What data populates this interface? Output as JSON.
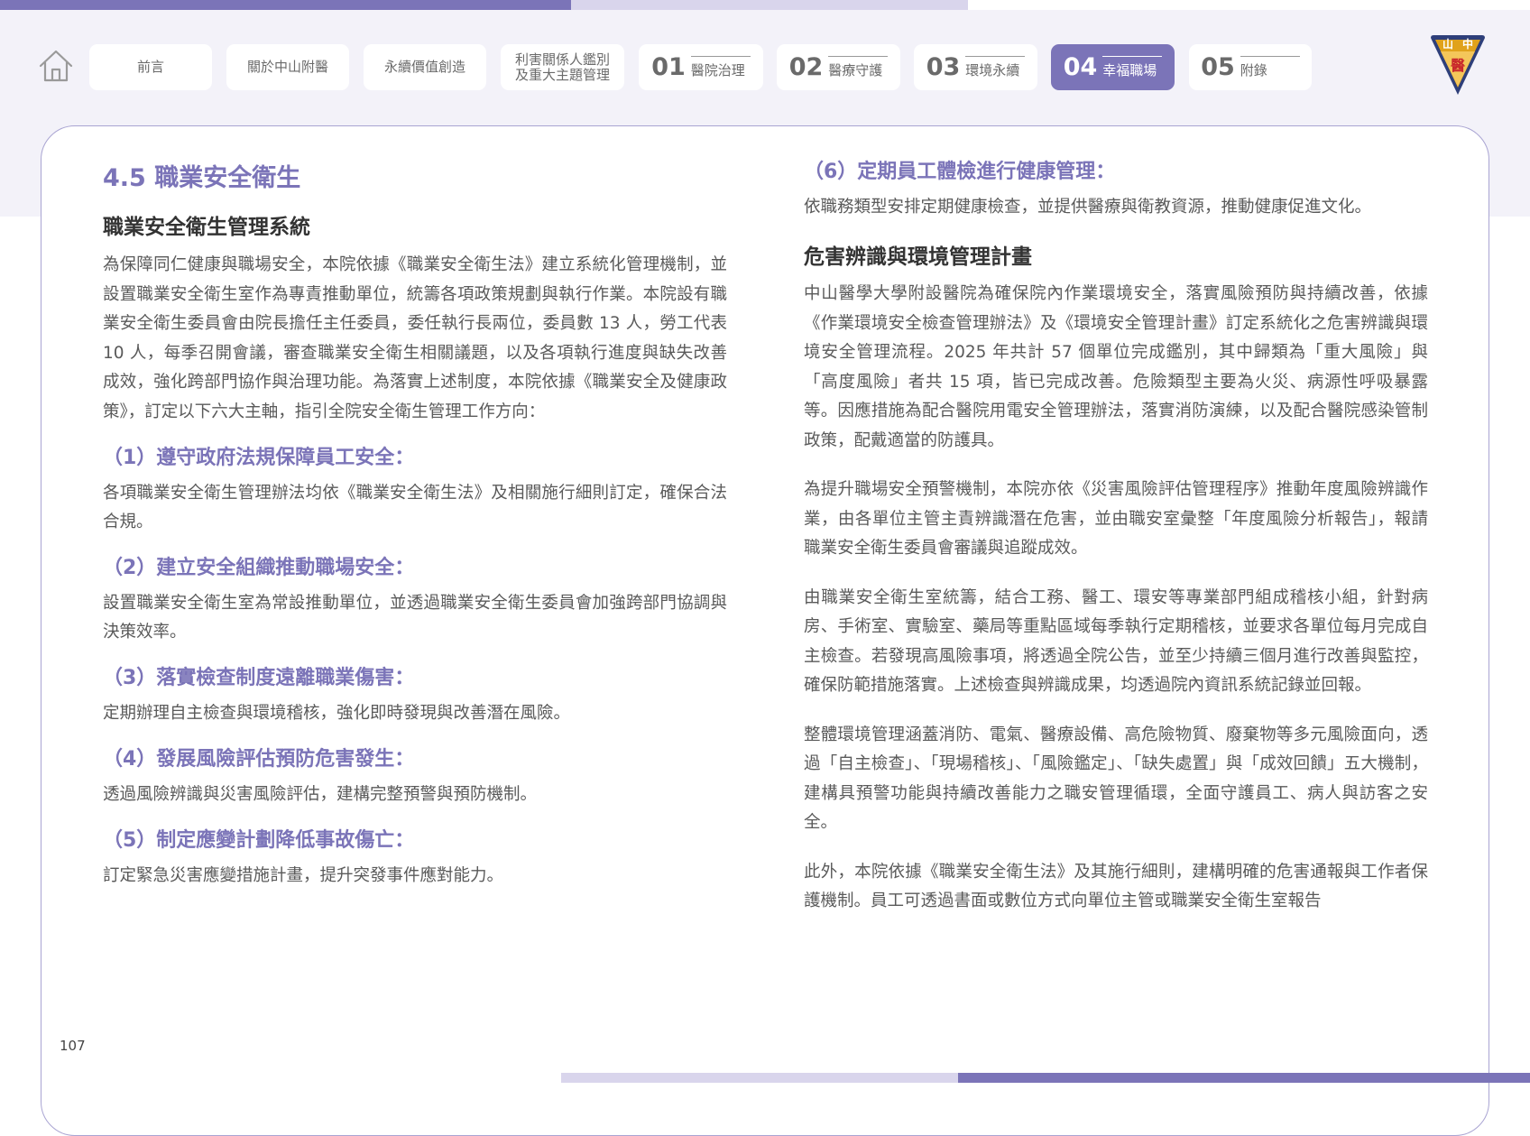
{
  "colors": {
    "accent": "#7b74b8",
    "accent_light": "#d9d5ec",
    "header_bg": "#f3f2f9",
    "body_text": "#5a5a5a",
    "logo_gold": "#e0a21b",
    "logo_navy": "#2e3f7a",
    "logo_red": "#c8262b"
  },
  "nav": {
    "home_icon": "home-icon",
    "tabs": [
      {
        "label": "前言"
      },
      {
        "label": "關於中山附醫"
      },
      {
        "label": "永續價值創造"
      },
      {
        "label": "利害關係人鑑別\n及重大主題管理"
      },
      {
        "num": "01",
        "label": "醫院治理"
      },
      {
        "num": "02",
        "label": "醫療守護"
      },
      {
        "num": "03",
        "label": "環境永續"
      },
      {
        "num": "04",
        "label": "幸福職場",
        "active": true
      },
      {
        "num": "05",
        "label": "附錄"
      }
    ]
  },
  "logo": {
    "icon": "hospital-emblem-icon",
    "text_left": "山",
    "text_right": "中",
    "text_center": "醫"
  },
  "left": {
    "section_title": "4.5 職業安全衛生",
    "subheading": "職業安全衛生管理系統",
    "intro": "為保障同仁健康與職場安全，本院依據《職業安全衛生法》建立系統化管理機制，並設置職業安全衛生室作為專責推動單位，統籌各項政策規劃與執行作業。本院設有職業安全衛生委員會由院長擔任主任委員，委任執行長兩位，委員數 13 人，勞工代表 10 人，每季召開會議，審查職業安全衛生相關議題，以及各項執行進度與缺失改善成效，強化跨部門協作與治理功能。為落實上述制度，本院依據《職業安全及健康政策》，訂定以下六大主軸，指引全院安全衛生管理工作方向：",
    "items": [
      {
        "title": "（1）遵守政府法規保障員工安全：",
        "desc": "各項職業安全衛生管理辦法均依《職業安全衛生法》及相關施行細則訂定，確保合法合規。"
      },
      {
        "title": "（2）建立安全組織推動職場安全：",
        "desc": "設置職業安全衛生室為常設推動單位，並透過職業安全衛生委員會加強跨部門協調與決策效率。"
      },
      {
        "title": "（3）落實檢查制度遠離職業傷害：",
        "desc": "定期辦理自主檢查與環境稽核，強化即時發現與改善潛在風險。"
      },
      {
        "title": "（4）發展風險評估預防危害發生：",
        "desc": "透過風險辨識與災害風險評估，建構完整預警與預防機制。"
      },
      {
        "title": "（5）制定應變計劃降低事故傷亡：",
        "desc": "訂定緊急災害應變措施計畫，提升突發事件應對能力。"
      }
    ]
  },
  "right": {
    "item6_title": "（6）定期員工體檢進行健康管理：",
    "item6_desc": "依職務類型安排定期健康檢查，並提供醫療與衛教資源，推動健康促進文化。",
    "subheading": "危害辨識與環境管理計畫",
    "paragraphs": [
      "中山醫學大學附設醫院為確保院內作業環境安全，落實風險預防與持續改善，依據《作業環境安全檢查管理辦法》及《環境安全管理計畫》訂定系統化之危害辨識與環境安全管理流程。2025 年共計 57 個單位完成鑑別，其中歸類為「重大風險」與「高度風險」者共 15 項，皆已完成改善。危險類型主要為火災、病源性呼吸暴露等。因應措施為配合醫院用電安全管理辦法，落實消防演練，以及配合醫院感染管制政策，配戴適當的防護具。",
      "為提升職場安全預警機制，本院亦依《災害風險評估管理程序》推動年度風險辨識作業，由各單位主管主責辨識潛在危害，並由職安室彙整「年度風險分析報告」，報請職業安全衛生委員會審議與追蹤成效。",
      "由職業安全衛生室統籌，結合工務、醫工、環安等專業部門組成稽核小組，針對病房、手術室、實驗室、藥局等重點區域每季執行定期稽核，並要求各單位每月完成自主檢查。若發現高風險事項，將透過全院公告，並至少持續三個月進行改善與監控，確保防範措施落實。上述檢查與辨識成果，均透過院內資訊系統記錄並回報。",
      "整體環境管理涵蓋消防、電氣、醫療設備、高危險物質、廢棄物等多元風險面向，透過「自主檢查」、「現場稽核」、「風險鑑定」、「缺失處置」與「成效回饋」五大機制，建構具預警功能與持續改善能力之職安管理循環，全面守護員工、病人與訪客之安全。",
      "此外，本院依據《職業安全衛生法》及其施行細則，建構明確的危害通報與工作者保護機制。員工可透過書面或數位方式向單位主管或職業安全衛生室報告"
    ]
  },
  "footer": {
    "page_number": "107"
  }
}
